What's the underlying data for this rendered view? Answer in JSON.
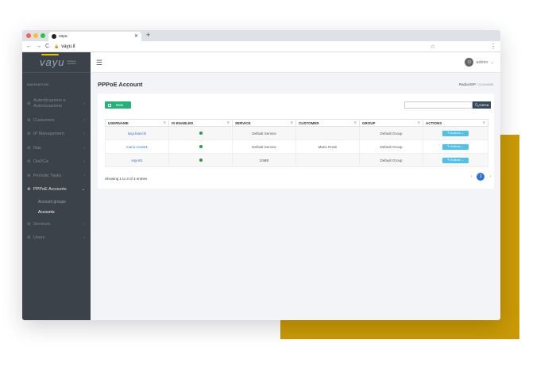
{
  "browser": {
    "tab_title": "vayu",
    "url": "vayu.it",
    "window_dots": [
      "#ff5f57",
      "#ffbd2e",
      "#28c840"
    ]
  },
  "app": {
    "logo_text": "vayu",
    "logo_sub": "wireless solutions",
    "brand_accent": "#e6c200",
    "user": "admin"
  },
  "sidebar": {
    "header": "NAVIGATION",
    "items": [
      {
        "label": "Autenticazione e Autorizzazione",
        "icon": "gear-icon"
      },
      {
        "label": "Customers",
        "icon": "gear-icon"
      },
      {
        "label": "IP Management",
        "icon": "gear-icon"
      },
      {
        "label": "Nas",
        "icon": "gear-icon"
      },
      {
        "label": "Dia2Ga",
        "icon": "gear-icon"
      },
      {
        "label": "Periodic Tasks",
        "icon": "gear-icon"
      },
      {
        "label": "PPPoE Accounts",
        "icon": "gear-icon"
      },
      {
        "label": "Services",
        "icon": "gear-icon"
      },
      {
        "label": "Users",
        "icon": "gear-icon"
      }
    ],
    "subitems": [
      "Account groups",
      "Accounts"
    ]
  },
  "page": {
    "title": "PPPoE Account",
    "breadcrumb_root": "RadiusISP",
    "breadcrumb_sep": "/",
    "breadcrumb_current": "Accounts"
  },
  "toolbar": {
    "new_label": "New",
    "search_label": "Cerca",
    "search_value": ""
  },
  "table": {
    "columns": [
      "USERNAME",
      "IS ENABLED",
      "SERVICE",
      "CUSTOMER",
      "GROUP",
      "ACTIONS"
    ],
    "rows": [
      {
        "username": "luigi.bianchi",
        "enabled": true,
        "service": "Default Service",
        "customer": "",
        "group": "Default Group",
        "action": "Actions"
      },
      {
        "username": "mario.rossi01",
        "enabled": true,
        "service": "Default Service",
        "customer": "Mario Rossi",
        "group": "Default Group",
        "action": "Actions"
      },
      {
        "username": "vayu01",
        "enabled": true,
        "service": "10MB",
        "customer": "",
        "group": "Default Group",
        "action": "Actions"
      }
    ],
    "info": "Showing 1 to 3 of 3 entries",
    "current_page": "1"
  }
}
